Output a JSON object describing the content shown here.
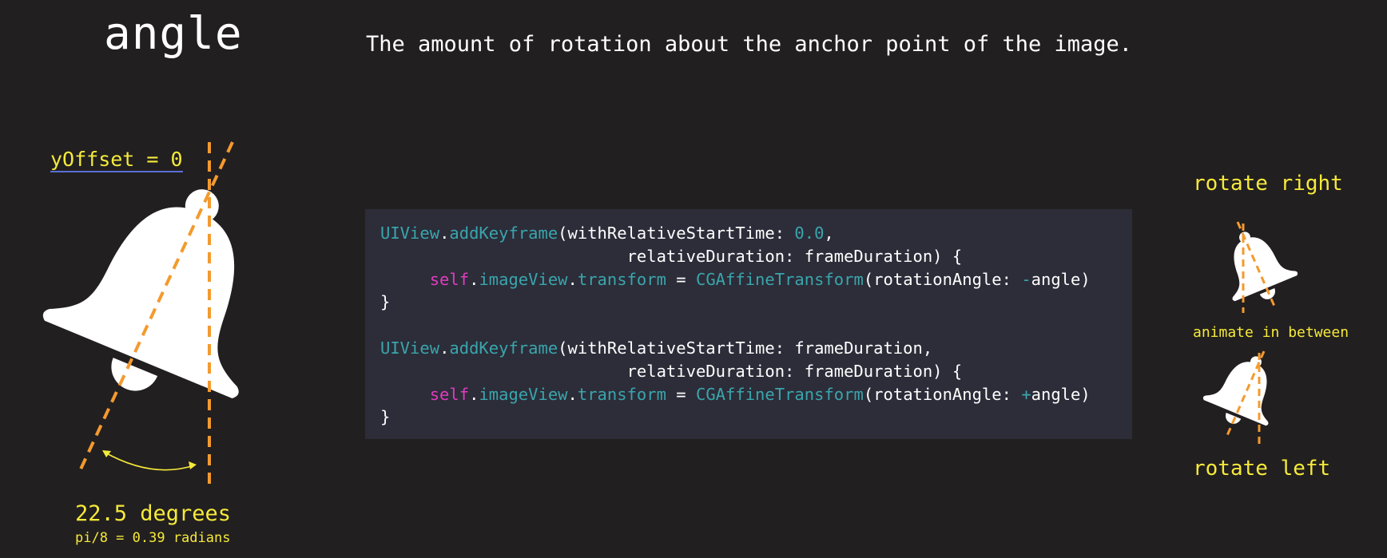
{
  "header": {
    "title": "angle",
    "subtitle": "The amount of rotation about the anchor point of the image."
  },
  "left": {
    "yoffset_label": "yOffset = 0",
    "degrees": "22.5 degrees",
    "radians": "pi/8 = 0.39 radians"
  },
  "right": {
    "rotate_right": "rotate right",
    "animate_between": "animate in between",
    "rotate_left": "rotate left"
  },
  "code": {
    "b1_l1": [
      "UIView",
      ".",
      "addKeyframe",
      "(withRelativeStartTime: ",
      "0.0",
      ","
    ],
    "b1_l2": "relativeDuration: frameDuration) {",
    "b1_l3": [
      "self",
      ".",
      "imageView",
      ".",
      "transform",
      " = ",
      "CGAffineTransform",
      "(rotationAngle: ",
      "-",
      "angle)"
    ],
    "b1_l4": "}",
    "b2_l1": [
      "UIView",
      ".",
      "addKeyframe",
      "(withRelativeStartTime: frameDuration,"
    ],
    "b2_l2": "relativeDuration: frameDuration) {",
    "b2_l3": [
      "self",
      ".",
      "imageView",
      ".",
      "transform",
      " = ",
      "CGAffineTransform",
      "(rotationAngle: ",
      "+",
      "angle)"
    ],
    "b2_l4": "}"
  },
  "colors": {
    "background": "#221f20",
    "code_background": "#2c2d39",
    "accent_yellow": "#f5ea3a",
    "guide_orange": "#f39a2e",
    "type_teal": "#3aa5ac",
    "keyword_magenta": "#e03cbf"
  },
  "icons": [
    "bell-icon",
    "rotation-arrow-icon"
  ]
}
